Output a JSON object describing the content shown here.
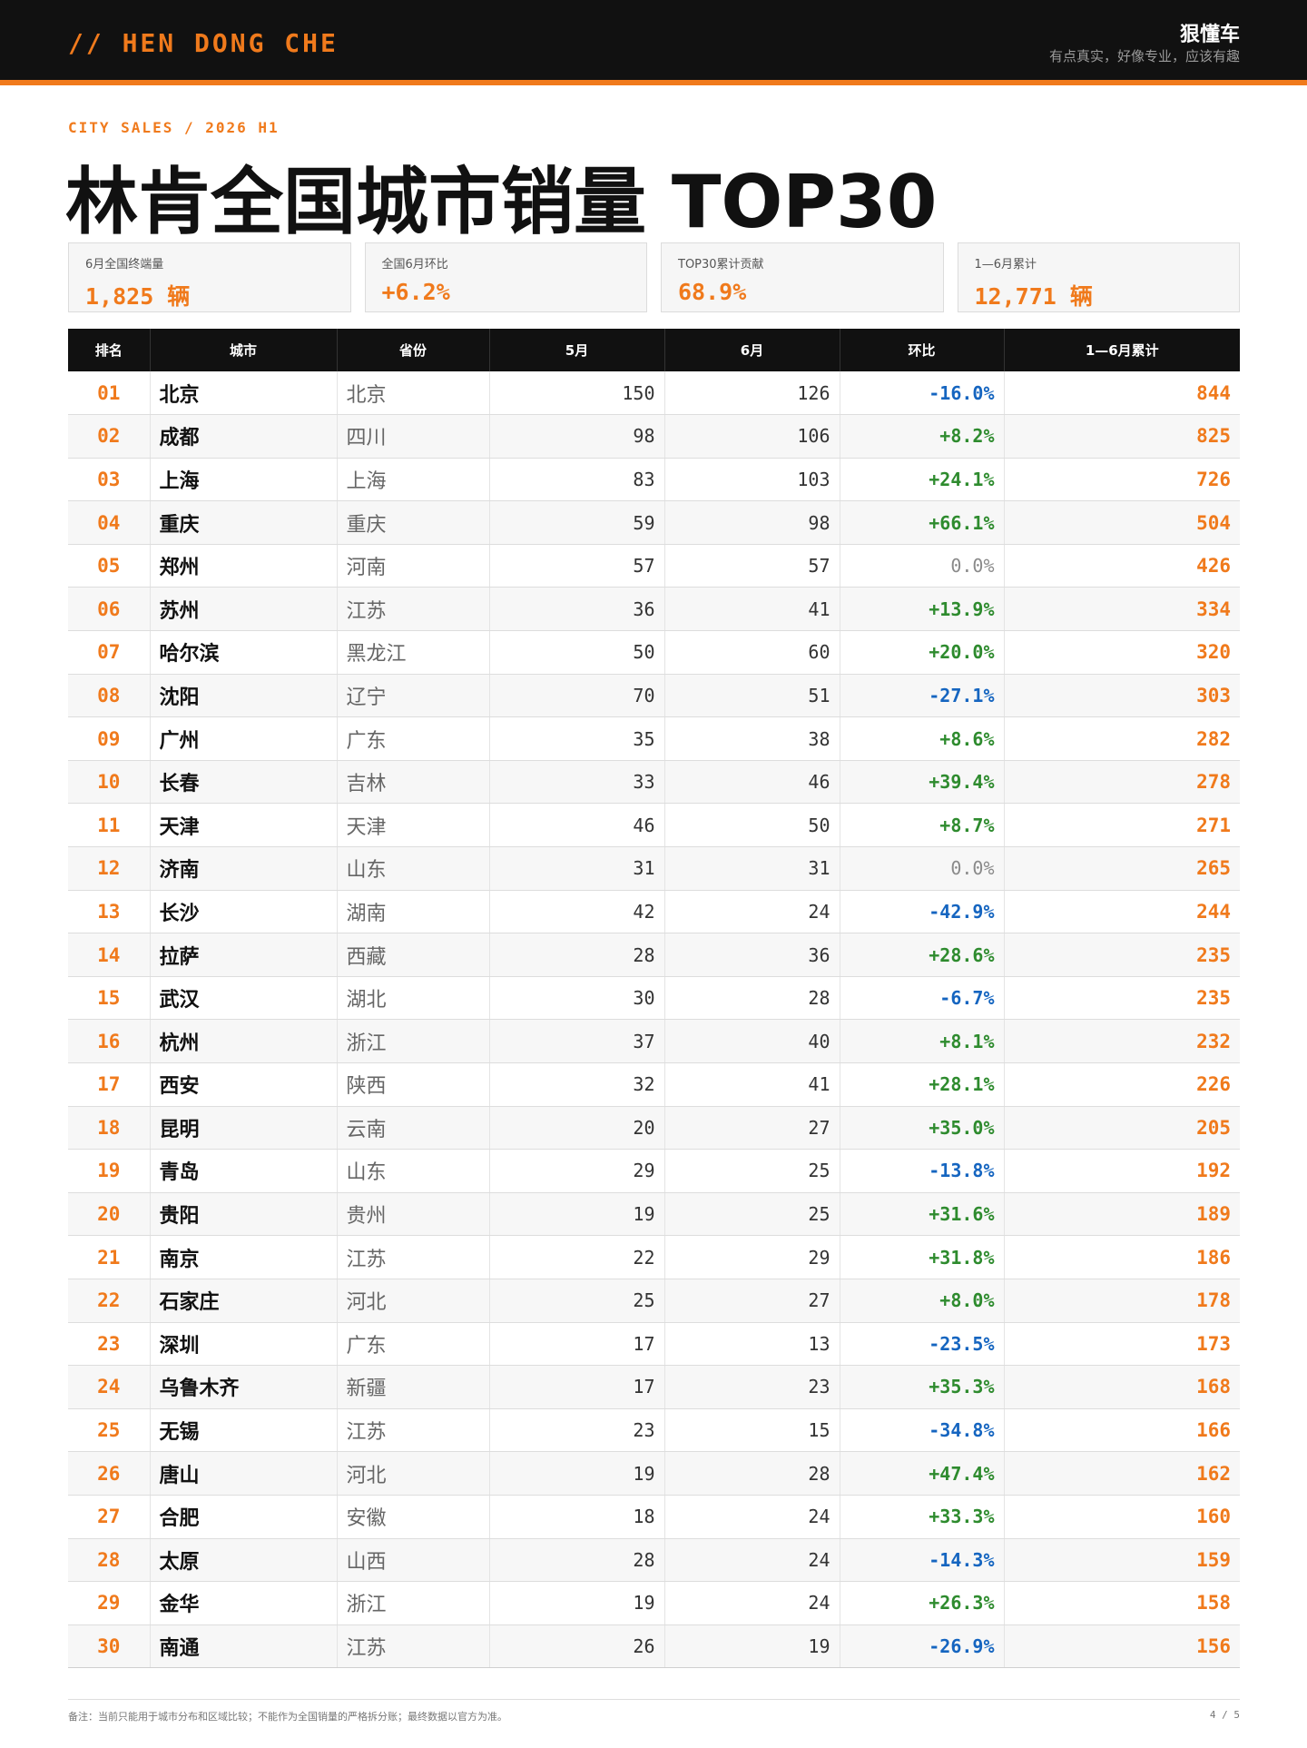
{
  "header": {
    "brand": "// HEN DONG CHE",
    "brand_cn": "狠懂车",
    "tagline": "有点真实，好像专业，应该有趣"
  },
  "kicker": "CITY SALES / 2026 H1",
  "title": "林肯全国城市销量 TOP30",
  "cards": [
    {
      "label": "6月全国终端量",
      "value": "1,825 辆"
    },
    {
      "label": "全国6月环比",
      "value": "+6.2%"
    },
    {
      "label": "TOP30累计贡献",
      "value": "68.9%"
    },
    {
      "label": "1—6月累计",
      "value": "12,771 辆"
    }
  ],
  "table": {
    "headers": [
      "排名",
      "城市",
      "省份",
      "5月",
      "6月",
      "环比",
      "1—6月累计"
    ],
    "rows": [
      {
        "rank": "01",
        "city": "北京",
        "province": "北京",
        "may": "150",
        "jun": "126",
        "change": "-16.0%",
        "dir": "neg",
        "cum": "844"
      },
      {
        "rank": "02",
        "city": "成都",
        "province": "四川",
        "may": "98",
        "jun": "106",
        "change": "+8.2%",
        "dir": "pos",
        "cum": "825"
      },
      {
        "rank": "03",
        "city": "上海",
        "province": "上海",
        "may": "83",
        "jun": "103",
        "change": "+24.1%",
        "dir": "pos",
        "cum": "726"
      },
      {
        "rank": "04",
        "city": "重庆",
        "province": "重庆",
        "may": "59",
        "jun": "98",
        "change": "+66.1%",
        "dir": "pos",
        "cum": "504"
      },
      {
        "rank": "05",
        "city": "郑州",
        "province": "河南",
        "may": "57",
        "jun": "57",
        "change": "0.0%",
        "dir": "zero",
        "cum": "426"
      },
      {
        "rank": "06",
        "city": "苏州",
        "province": "江苏",
        "may": "36",
        "jun": "41",
        "change": "+13.9%",
        "dir": "pos",
        "cum": "334"
      },
      {
        "rank": "07",
        "city": "哈尔滨",
        "province": "黑龙江",
        "may": "50",
        "jun": "60",
        "change": "+20.0%",
        "dir": "pos",
        "cum": "320"
      },
      {
        "rank": "08",
        "city": "沈阳",
        "province": "辽宁",
        "may": "70",
        "jun": "51",
        "change": "-27.1%",
        "dir": "neg",
        "cum": "303"
      },
      {
        "rank": "09",
        "city": "广州",
        "province": "广东",
        "may": "35",
        "jun": "38",
        "change": "+8.6%",
        "dir": "pos",
        "cum": "282"
      },
      {
        "rank": "10",
        "city": "长春",
        "province": "吉林",
        "may": "33",
        "jun": "46",
        "change": "+39.4%",
        "dir": "pos",
        "cum": "278"
      },
      {
        "rank": "11",
        "city": "天津",
        "province": "天津",
        "may": "46",
        "jun": "50",
        "change": "+8.7%",
        "dir": "pos",
        "cum": "271"
      },
      {
        "rank": "12",
        "city": "济南",
        "province": "山东",
        "may": "31",
        "jun": "31",
        "change": "0.0%",
        "dir": "zero",
        "cum": "265"
      },
      {
        "rank": "13",
        "city": "长沙",
        "province": "湖南",
        "may": "42",
        "jun": "24",
        "change": "-42.9%",
        "dir": "neg",
        "cum": "244"
      },
      {
        "rank": "14",
        "city": "拉萨",
        "province": "西藏",
        "may": "28",
        "jun": "36",
        "change": "+28.6%",
        "dir": "pos",
        "cum": "235"
      },
      {
        "rank": "15",
        "city": "武汉",
        "province": "湖北",
        "may": "30",
        "jun": "28",
        "change": "-6.7%",
        "dir": "neg",
        "cum": "235"
      },
      {
        "rank": "16",
        "city": "杭州",
        "province": "浙江",
        "may": "37",
        "jun": "40",
        "change": "+8.1%",
        "dir": "pos",
        "cum": "232"
      },
      {
        "rank": "17",
        "city": "西安",
        "province": "陕西",
        "may": "32",
        "jun": "41",
        "change": "+28.1%",
        "dir": "pos",
        "cum": "226"
      },
      {
        "rank": "18",
        "city": "昆明",
        "province": "云南",
        "may": "20",
        "jun": "27",
        "change": "+35.0%",
        "dir": "pos",
        "cum": "205"
      },
      {
        "rank": "19",
        "city": "青岛",
        "province": "山东",
        "may": "29",
        "jun": "25",
        "change": "-13.8%",
        "dir": "neg",
        "cum": "192"
      },
      {
        "rank": "20",
        "city": "贵阳",
        "province": "贵州",
        "may": "19",
        "jun": "25",
        "change": "+31.6%",
        "dir": "pos",
        "cum": "189"
      },
      {
        "rank": "21",
        "city": "南京",
        "province": "江苏",
        "may": "22",
        "jun": "29",
        "change": "+31.8%",
        "dir": "pos",
        "cum": "186"
      },
      {
        "rank": "22",
        "city": "石家庄",
        "province": "河北",
        "may": "25",
        "jun": "27",
        "change": "+8.0%",
        "dir": "pos",
        "cum": "178"
      },
      {
        "rank": "23",
        "city": "深圳",
        "province": "广东",
        "may": "17",
        "jun": "13",
        "change": "-23.5%",
        "dir": "neg",
        "cum": "173"
      },
      {
        "rank": "24",
        "city": "乌鲁木齐",
        "province": "新疆",
        "may": "17",
        "jun": "23",
        "change": "+35.3%",
        "dir": "pos",
        "cum": "168"
      },
      {
        "rank": "25",
        "city": "无锡",
        "province": "江苏",
        "may": "23",
        "jun": "15",
        "change": "-34.8%",
        "dir": "neg",
        "cum": "166"
      },
      {
        "rank": "26",
        "city": "唐山",
        "province": "河北",
        "may": "19",
        "jun": "28",
        "change": "+47.4%",
        "dir": "pos",
        "cum": "162"
      },
      {
        "rank": "27",
        "city": "合肥",
        "province": "安徽",
        "may": "18",
        "jun": "24",
        "change": "+33.3%",
        "dir": "pos",
        "cum": "160"
      },
      {
        "rank": "28",
        "city": "太原",
        "province": "山西",
        "may": "28",
        "jun": "24",
        "change": "-14.3%",
        "dir": "neg",
        "cum": "159"
      },
      {
        "rank": "29",
        "city": "金华",
        "province": "浙江",
        "may": "19",
        "jun": "24",
        "change": "+26.3%",
        "dir": "pos",
        "cum": "158"
      },
      {
        "rank": "30",
        "city": "南通",
        "province": "江苏",
        "may": "26",
        "jun": "19",
        "change": "-26.9%",
        "dir": "neg",
        "cum": "156"
      }
    ]
  },
  "footer": {
    "note": "备注：当前只能用于城市分布和区域比较；不能作为全国销量的严格拆分账；最终数据以官方为准。",
    "page": "4 / 5"
  },
  "colors": {
    "accent": "#f07a1c",
    "positive": "#2e8b2e",
    "negative": "#1565c0",
    "header_bg": "#111111"
  }
}
